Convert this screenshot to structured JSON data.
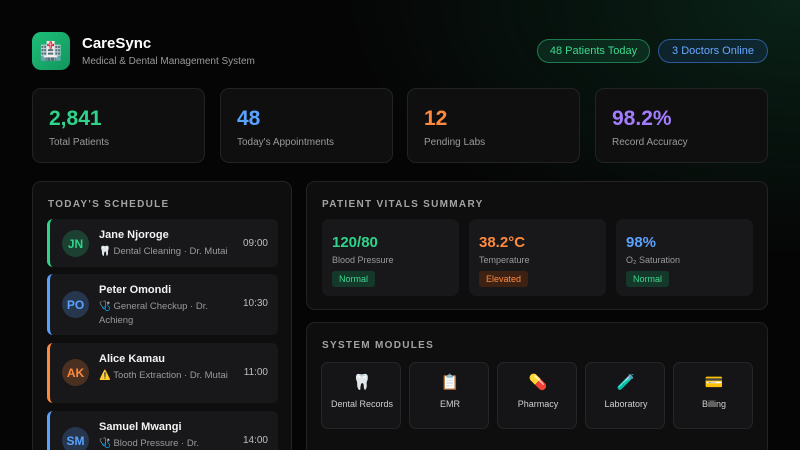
{
  "header": {
    "logo_icon": "hospital-icon",
    "title": "CareSync",
    "subtitle": "Medical & Dental Management System",
    "patients_pill": "48 Patients Today",
    "doctors_pill": "3 Doctors Online"
  },
  "stats": [
    {
      "value": "2,841",
      "label": "Total Patients",
      "color": "#2fd38a"
    },
    {
      "value": "48",
      "label": "Today's Appointments",
      "color": "#5aa2ff"
    },
    {
      "value": "12",
      "label": "Pending Labs",
      "color": "#ff8a3d"
    },
    {
      "value": "98.2%",
      "label": "Record Accuracy",
      "color": "#a37cff"
    }
  ],
  "schedule": {
    "title": "TODAY'S SCHEDULE",
    "items": [
      {
        "initials": "JN",
        "name": "Jane Njoroge",
        "icon": "tooth-icon",
        "desc": "Dental Cleaning · Dr. Mutai",
        "time": "09:00",
        "color": "#2fd38a"
      },
      {
        "initials": "PO",
        "name": "Peter Omondi",
        "icon": "stethoscope-icon",
        "desc": "General Checkup · Dr. Achieng",
        "time": "10:30",
        "color": "#5aa2ff"
      },
      {
        "initials": "AK",
        "name": "Alice Kamau",
        "icon": "warning-icon",
        "desc": "Tooth Extraction · Dr. Mutai",
        "time": "11:00",
        "color": "#ff8a3d"
      },
      {
        "initials": "SM",
        "name": "Samuel Mwangi",
        "icon": "stethoscope-icon",
        "desc": "Blood Pressure · Dr.",
        "time": "14:00",
        "color": "#5aa2ff"
      }
    ]
  },
  "vitals": {
    "title": "PATIENT VITALS SUMMARY",
    "items": [
      {
        "value": "120/80",
        "label": "Blood Pressure",
        "badge": "Normal",
        "status": "normal",
        "color": "#2fd38a"
      },
      {
        "value": "38.2°C",
        "label": "Temperature",
        "badge": "Elevated",
        "status": "elevated",
        "color": "#ff8a3d"
      },
      {
        "value": "98%",
        "label": "O₂ Saturation",
        "badge": "Normal",
        "status": "normal",
        "color": "#5aa2ff"
      }
    ]
  },
  "modules": {
    "title": "SYSTEM MODULES",
    "items": [
      {
        "label": "Dental Records",
        "icon": "tooth-icon",
        "glyph": "🦷"
      },
      {
        "label": "EMR",
        "icon": "clipboard-icon",
        "glyph": "📋"
      },
      {
        "label": "Pharmacy",
        "icon": "pill-icon",
        "glyph": "💊"
      },
      {
        "label": "Laboratory",
        "icon": "test-tube-icon",
        "glyph": "🧪"
      },
      {
        "label": "Billing",
        "icon": "credit-card-icon",
        "glyph": "💳"
      }
    ]
  }
}
